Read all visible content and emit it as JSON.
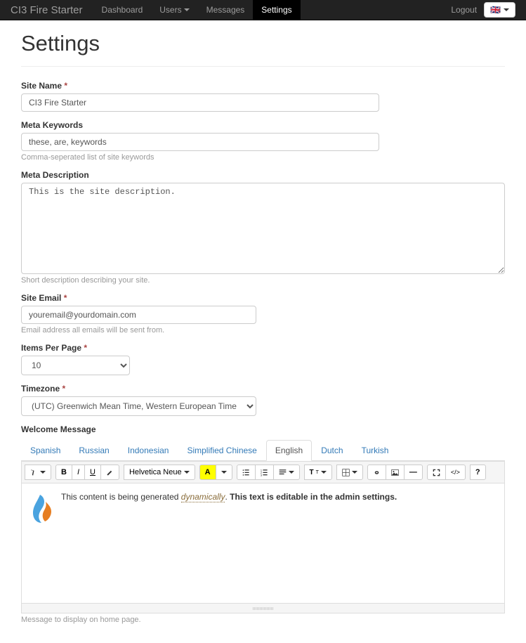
{
  "navbar": {
    "brand": "CI3 Fire Starter",
    "items": [
      {
        "label": "Dashboard",
        "active": false,
        "dropdown": false
      },
      {
        "label": "Users",
        "active": false,
        "dropdown": true
      },
      {
        "label": "Messages",
        "active": false,
        "dropdown": false
      },
      {
        "label": "Settings",
        "active": true,
        "dropdown": false
      }
    ],
    "logout": "Logout",
    "lang_flag": "🇬🇧"
  },
  "page_title": "Settings",
  "fields": {
    "site_name": {
      "label": "Site Name",
      "required": true,
      "value": "CI3 Fire Starter"
    },
    "meta_keywords": {
      "label": "Meta Keywords",
      "required": false,
      "value": "these, are, keywords",
      "help": "Comma-seperated list of site keywords"
    },
    "meta_description": {
      "label": "Meta Description",
      "required": false,
      "value": "This is the site description.",
      "help": "Short description describing your site."
    },
    "site_email": {
      "label": "Site Email",
      "required": true,
      "value": "youremail@yourdomain.com",
      "help": "Email address all emails will be sent from."
    },
    "items_per_page": {
      "label": "Items Per Page",
      "required": true,
      "value": "10"
    },
    "timezone": {
      "label": "Timezone",
      "required": true,
      "value": "(UTC) Greenwich Mean Time, Western European Time"
    },
    "welcome_message": {
      "label": "Welcome Message",
      "help": "Message to display on home page."
    }
  },
  "tabs": [
    "Spanish",
    "Russian",
    "Indonesian",
    "Simplified Chinese",
    "English",
    "Dutch",
    "Turkish"
  ],
  "active_tab": "English",
  "editor": {
    "font_name": "Helvetica Neue",
    "content_prefix": "This content is being generated ",
    "content_dynamic": "dynamically",
    "content_suffix": ". ",
    "content_bold": "This text is editable in the admin settings."
  }
}
